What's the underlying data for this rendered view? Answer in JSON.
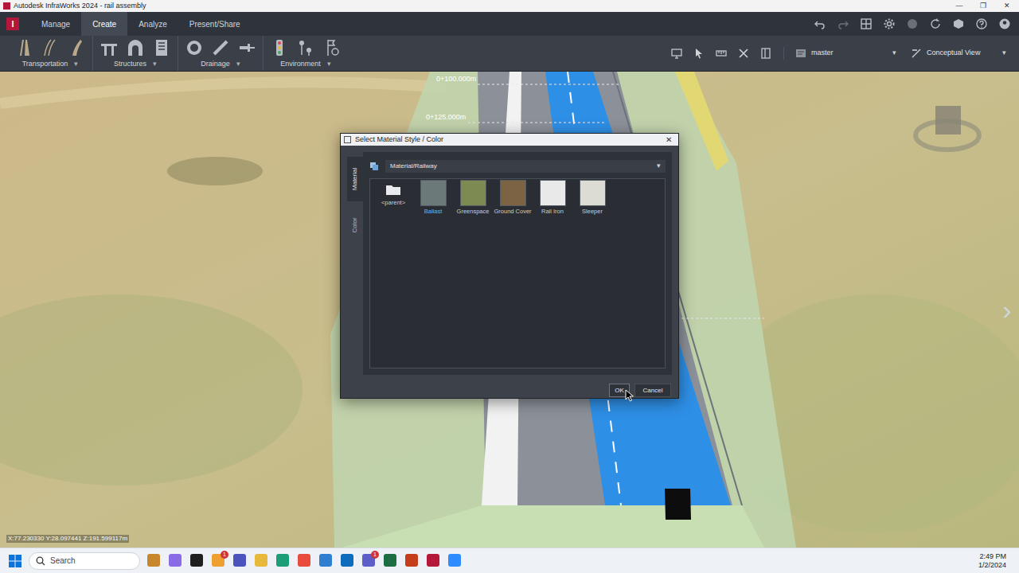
{
  "window": {
    "title": "Autodesk InfraWorks 2024 - rail assembly",
    "controls": [
      "—",
      "❐",
      "✕"
    ]
  },
  "app": {
    "logo": "I"
  },
  "ribbon_tabs": [
    {
      "label": "Manage",
      "selected": false
    },
    {
      "label": "Create",
      "selected": true
    },
    {
      "label": "Analyze",
      "selected": false
    },
    {
      "label": "Present/Share",
      "selected": false
    }
  ],
  "ribbon_groups": [
    {
      "label": "Transportation",
      "arrow": "▾"
    },
    {
      "label": "Structures",
      "arrow": "▾"
    },
    {
      "label": "Drainage",
      "arrow": "▾"
    },
    {
      "label": "Environment",
      "arrow": "▾"
    }
  ],
  "branch": {
    "value": "master",
    "arrow": "▾"
  },
  "view": {
    "value": "Conceptual View",
    "arrow": "▾"
  },
  "viewport": {
    "stations": [
      "0+100.000m",
      "0+125.000m"
    ],
    "coordinates": "X:77.230330 Y:28.097441 Z:191.599117m",
    "side_arrow": "›"
  },
  "dialog": {
    "title": "Select Material Style / Color",
    "close": "✕",
    "side_tabs": [
      {
        "label": "Material",
        "selected": true
      },
      {
        "label": "Color",
        "selected": false
      }
    ],
    "path": "Material/Railway",
    "path_arrow": "▾",
    "items": [
      {
        "label": "<parent>",
        "kind": "folder",
        "selected": false
      },
      {
        "label": "Ballast",
        "kind": "material",
        "selected": true,
        "color": "#6b7a78"
      },
      {
        "label": "Greenspace",
        "kind": "material",
        "selected": false,
        "color": "#7d8a52"
      },
      {
        "label": "Ground Cover",
        "kind": "material",
        "selected": false,
        "color": "#7b6343"
      },
      {
        "label": "Rail Iron",
        "kind": "material",
        "selected": false,
        "color": "#e9e9e9"
      },
      {
        "label": "Sleeper",
        "kind": "material",
        "selected": false,
        "color": "#dcdcd4"
      }
    ],
    "buttons": [
      {
        "label": "OK",
        "selected": true
      },
      {
        "label": "Cancel",
        "selected": false
      }
    ]
  },
  "taskbar": {
    "search": "Search",
    "time": "2:49 PM",
    "date": "1/2/2024",
    "apps": [
      {
        "color": "#c7862b"
      },
      {
        "color": "#8a6be6"
      },
      {
        "color": "#1f1f1f"
      },
      {
        "color": "#f0a030",
        "badge": "1"
      },
      {
        "color": "#4b53bc"
      },
      {
        "color": "#e8b83a"
      },
      {
        "color": "#1b9e77"
      },
      {
        "color": "#e94b3c"
      },
      {
        "color": "#2f7fd0"
      },
      {
        "color": "#0f6cbd"
      },
      {
        "color": "#5b5fc7",
        "badge": "1"
      },
      {
        "color": "#1d6f42"
      },
      {
        "color": "#c43e1c"
      },
      {
        "color": "#b5173b"
      },
      {
        "color": "#2d8cff"
      }
    ]
  }
}
